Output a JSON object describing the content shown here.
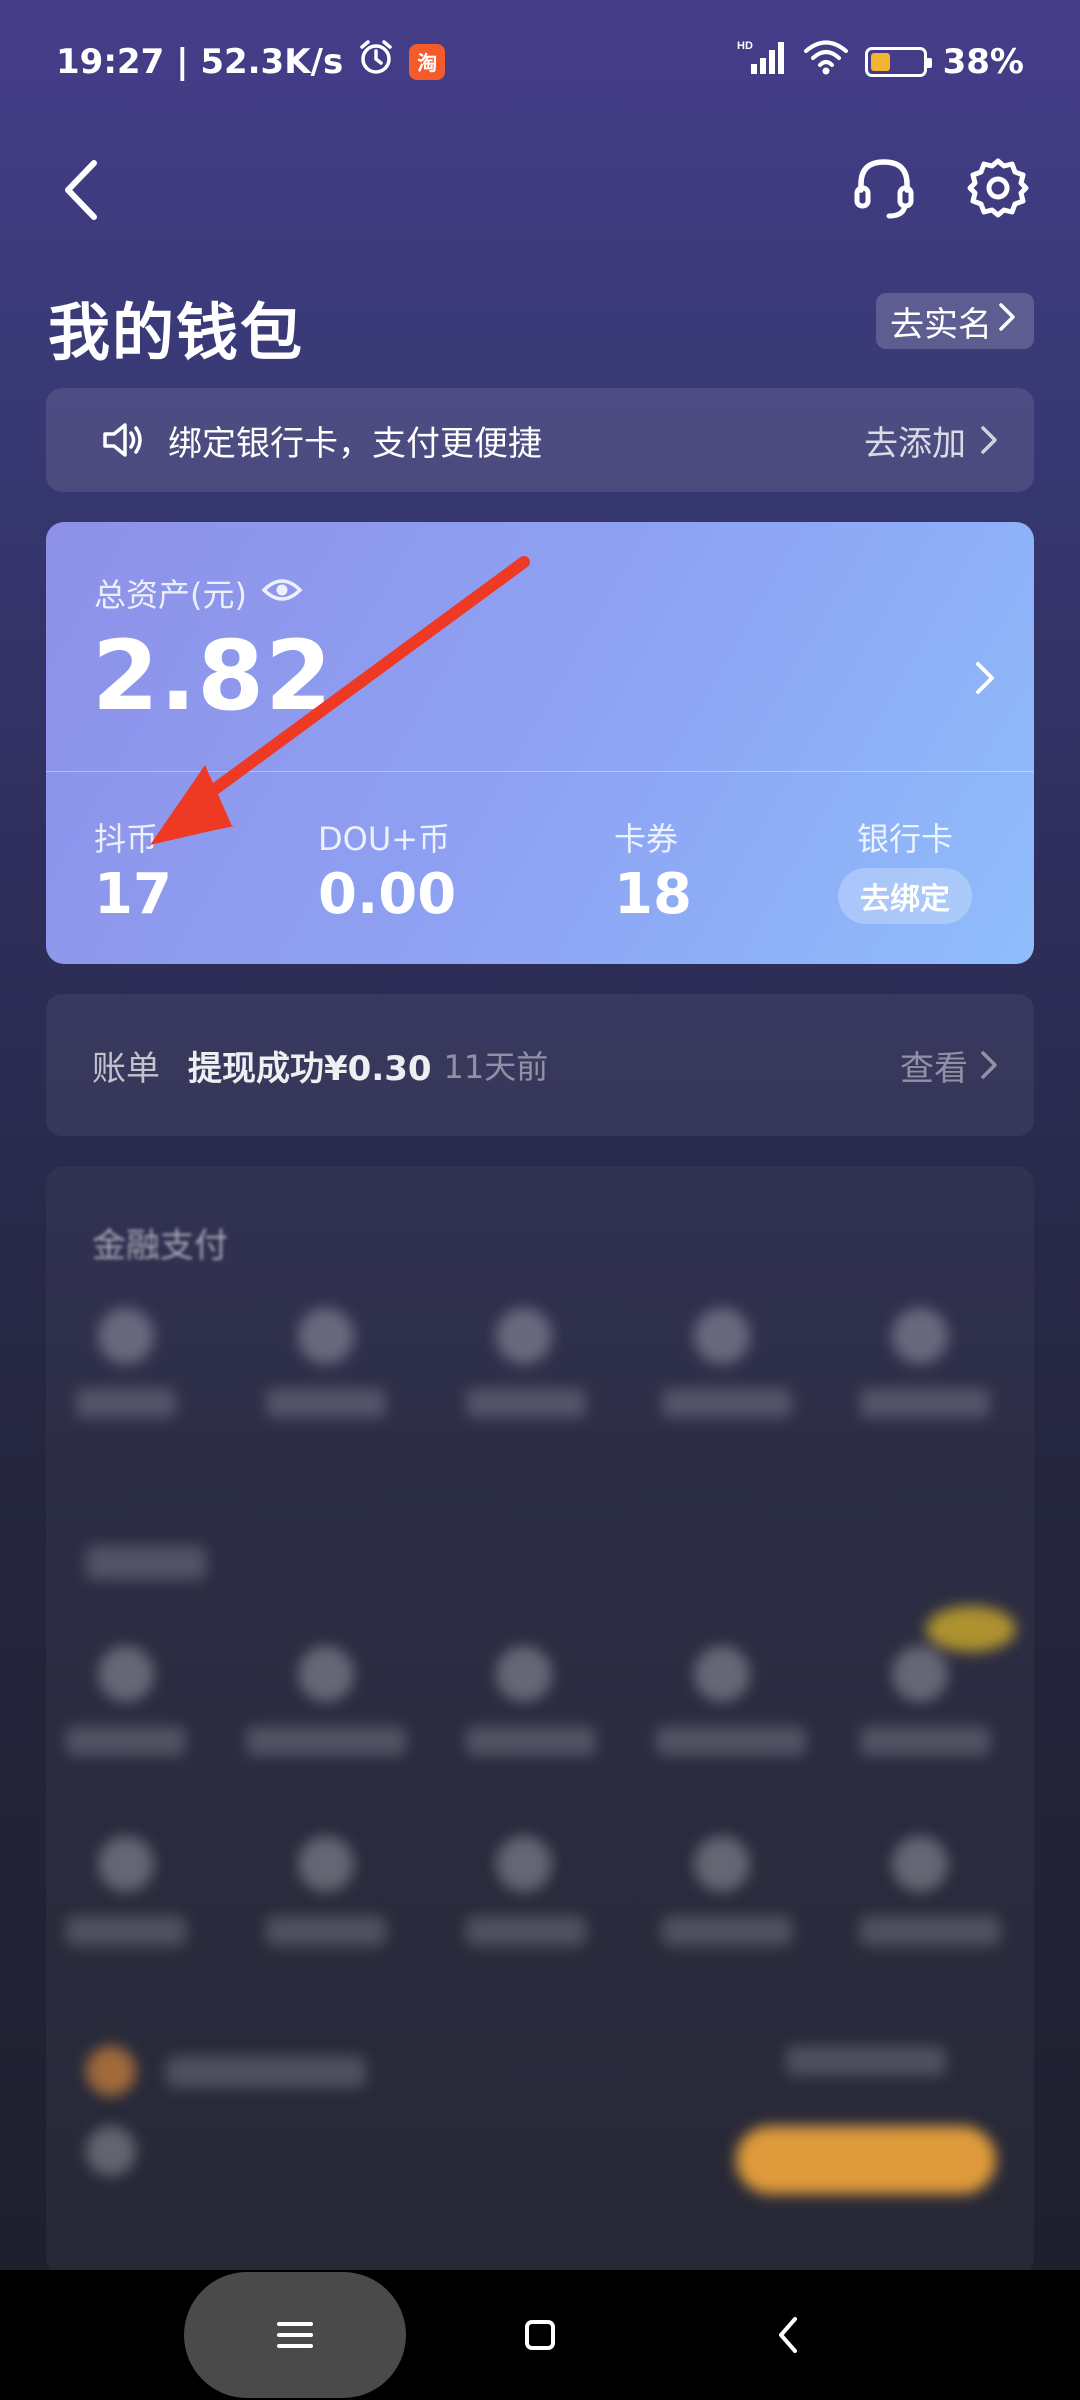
{
  "status_bar": {
    "time_speed": "19:27 | 52.3K/s",
    "battery": "38%",
    "battery_level": 0.38
  },
  "header": {
    "title": "我的钱包",
    "realname_label": "去实名"
  },
  "banner": {
    "text": "绑定银行卡，支付更便捷",
    "action": "去添加"
  },
  "assets": {
    "label": "总资产(元)",
    "amount": "2.82",
    "items": [
      {
        "label": "抖币",
        "value": "17"
      },
      {
        "label": "DOU+币",
        "value": "0.00"
      },
      {
        "label": "卡券",
        "value": "18"
      },
      {
        "label": "银行卡",
        "button": "去绑定"
      }
    ]
  },
  "bill": {
    "label": "账单",
    "text": "提现成功¥0.30",
    "time": "11天前",
    "view": "查看"
  },
  "finance": {
    "title": "金融支付"
  },
  "colors": {
    "annotation_arrow": "#ee3a25",
    "card_start": "#8d91e8",
    "card_end": "#8fbdfb"
  }
}
